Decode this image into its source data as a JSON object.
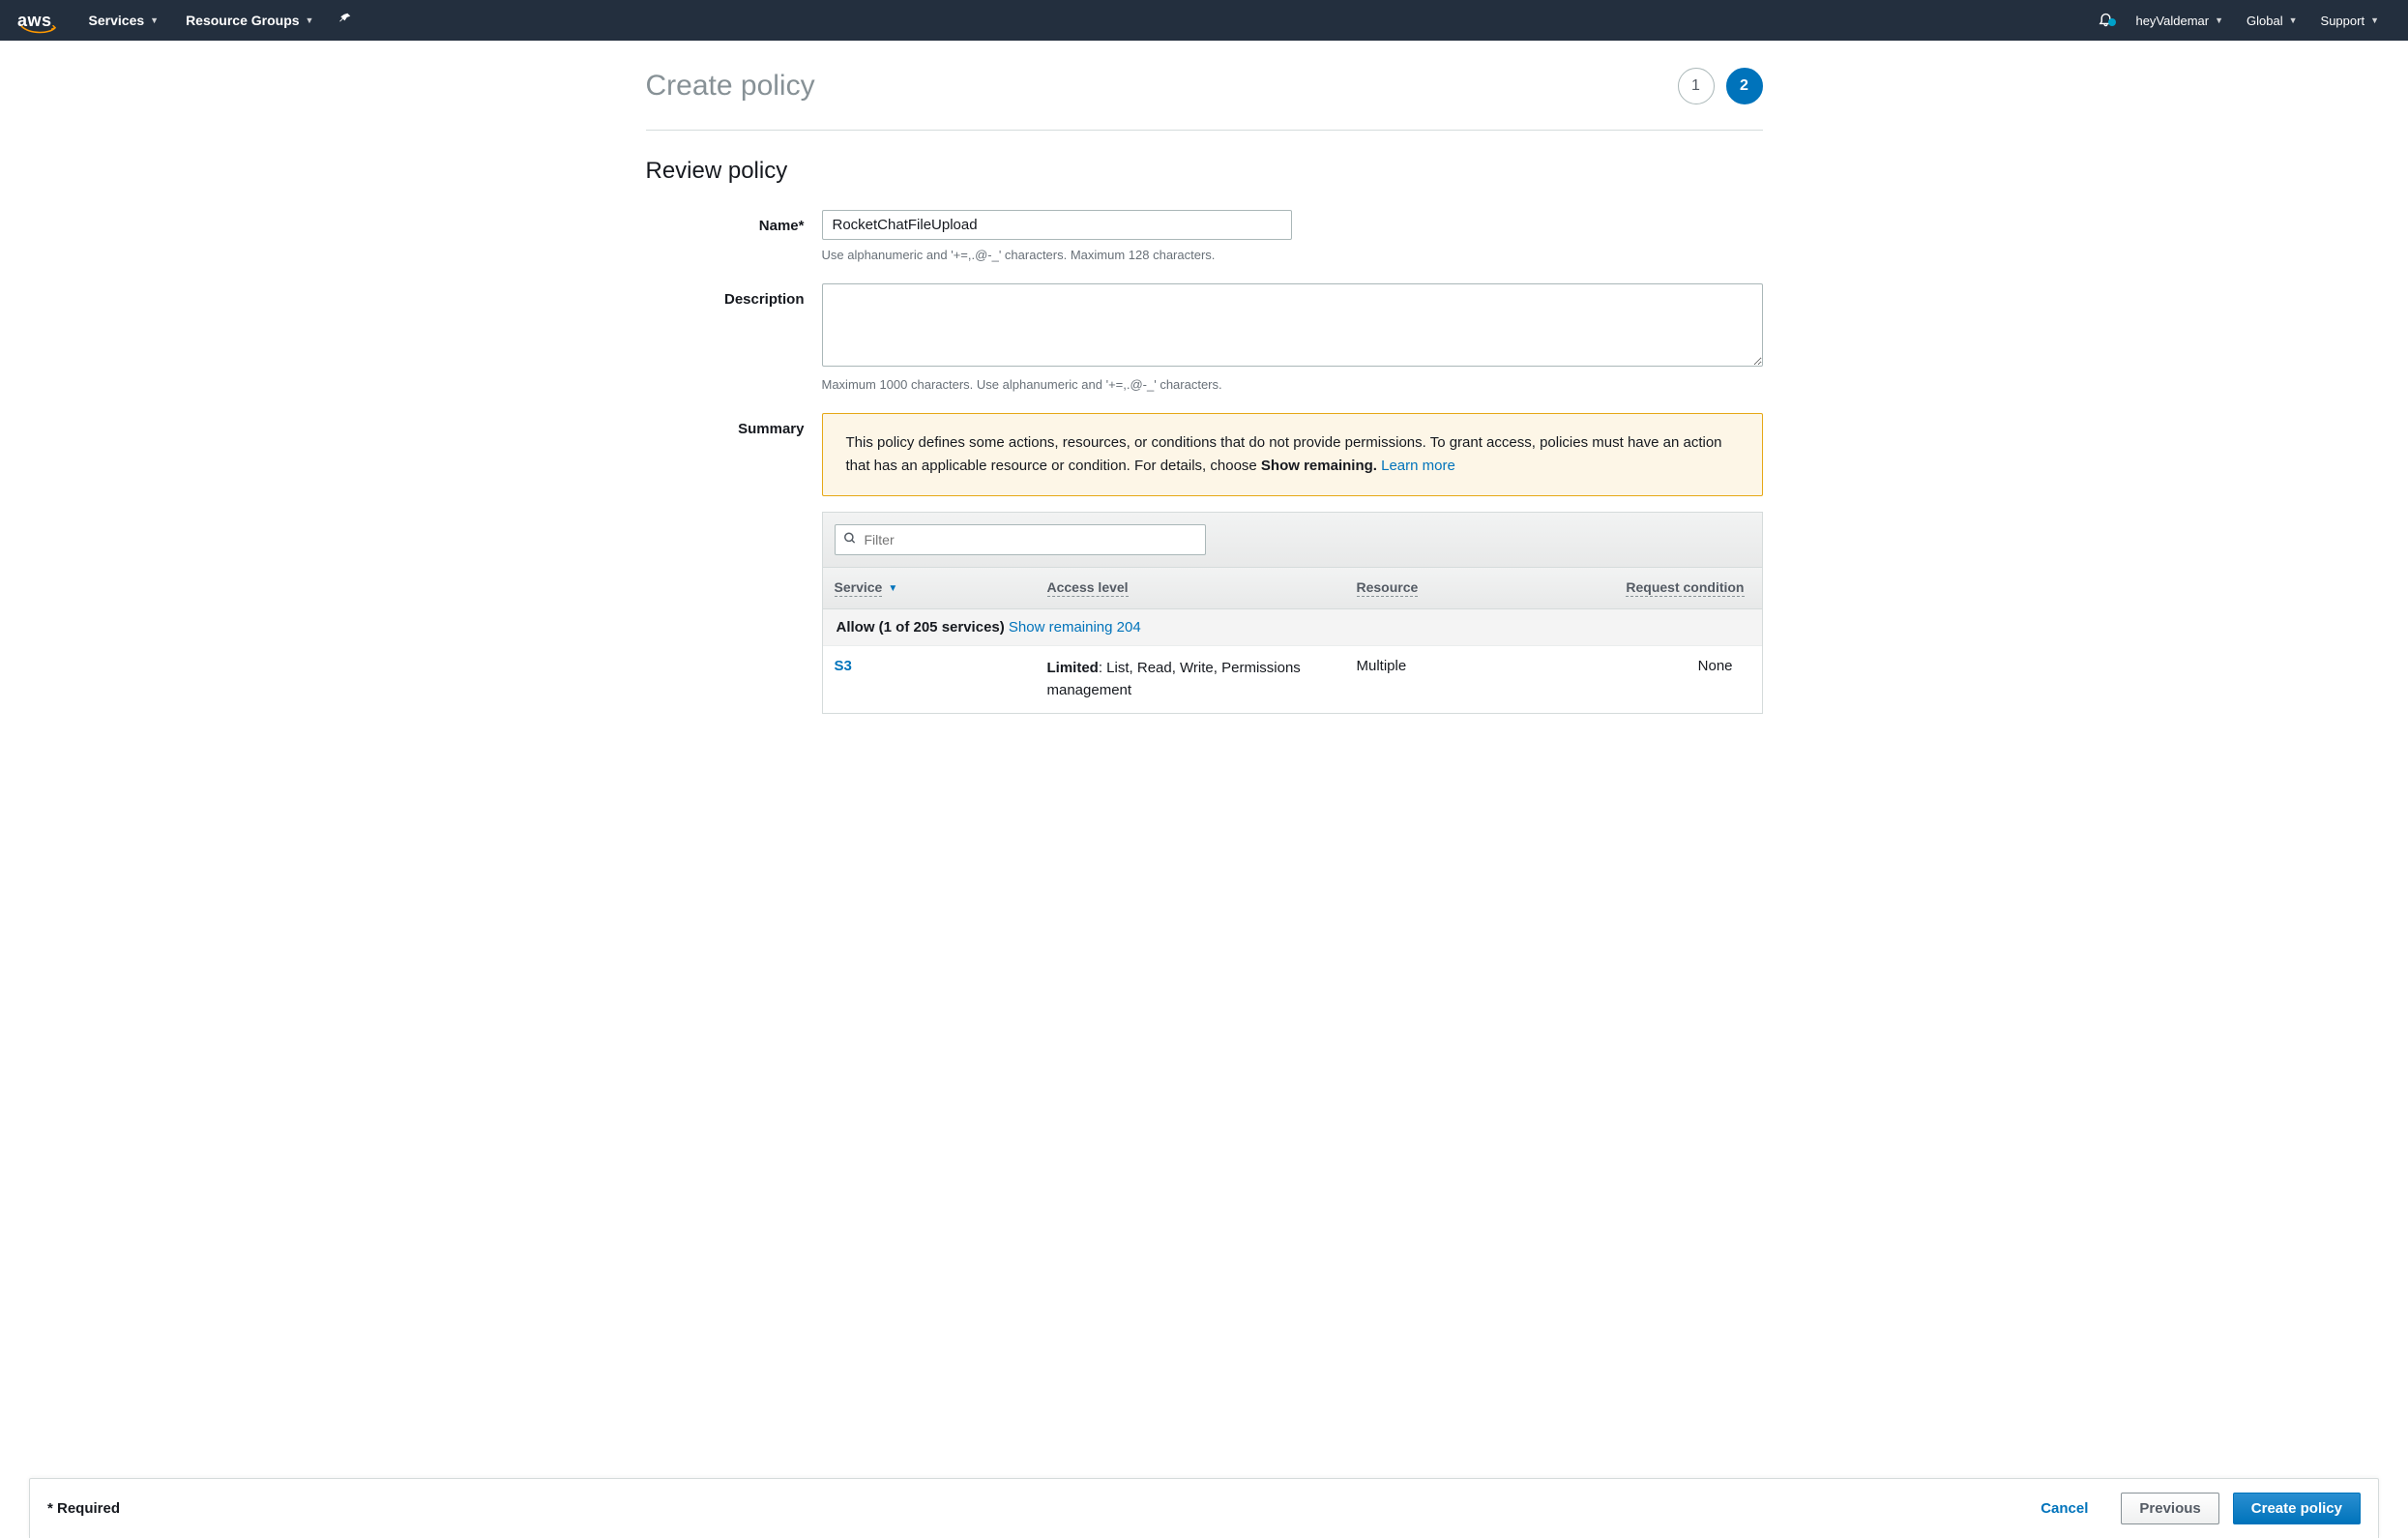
{
  "topbar": {
    "logo_text": "aws",
    "services_label": "Services",
    "resource_groups_label": "Resource Groups",
    "user_label": "heyValdemar",
    "region_label": "Global",
    "support_label": "Support"
  },
  "page": {
    "title": "Create policy",
    "steps": {
      "step1": "1",
      "step2": "2"
    }
  },
  "section": {
    "title": "Review policy"
  },
  "form": {
    "name": {
      "label": "Name*",
      "value": "RocketChatFileUpload",
      "hint": "Use alphanumeric and '+=,.@-_' characters. Maximum 128 characters."
    },
    "description": {
      "label": "Description",
      "value": "",
      "hint": "Maximum 1000 characters. Use alphanumeric and '+=,.@-_' characters."
    },
    "summary": {
      "label": "Summary",
      "alert_before": "This policy defines some actions, resources, or conditions that do not provide permissions. To grant access, policies must have an action that has an applicable resource or condition. For details, choose ",
      "alert_bold": "Show remaining.",
      "learn_more": "Learn more"
    }
  },
  "table": {
    "filter_placeholder": "Filter",
    "headers": {
      "service": "Service",
      "access": "Access level",
      "resource": "Resource",
      "condition": "Request condition"
    },
    "group": {
      "label_bold": "Allow (1 of 205 services) ",
      "link": "Show remaining 204"
    },
    "rows": [
      {
        "service": "S3",
        "access_bold": "Limited",
        "access_rest": ": List, Read, Write, Permissions management",
        "resource": "Multiple",
        "condition": "None"
      }
    ]
  },
  "footer": {
    "required_note": "* Required",
    "cancel": "Cancel",
    "previous": "Previous",
    "create": "Create policy"
  }
}
